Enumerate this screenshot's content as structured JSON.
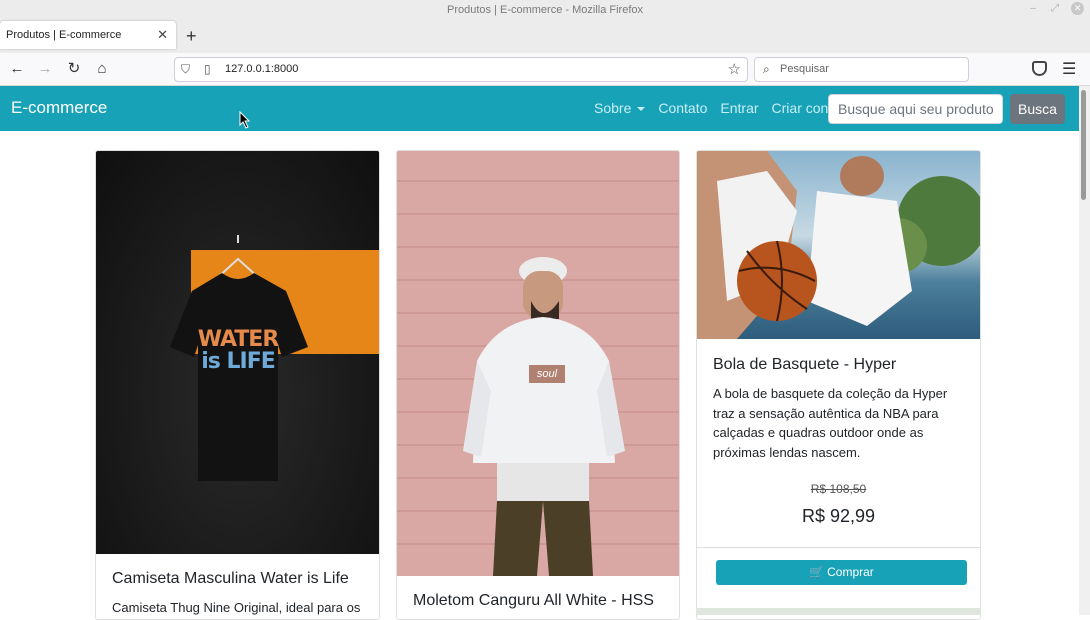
{
  "window": {
    "title": "Produtos | E-commerce - Mozilla Firefox"
  },
  "tab": {
    "label": "Produtos | E-commerce"
  },
  "browser": {
    "url": "127.0.0.1:8000",
    "search_placeholder": "Pesquisar"
  },
  "site": {
    "brand": "E-commerce",
    "nav": {
      "sobre": "Sobre",
      "contato": "Contato",
      "entrar": "Entrar",
      "criar_conta": "Criar conta"
    },
    "search_placeholder": "Busque aqui seu produto",
    "search_button": "Busca"
  },
  "products": [
    {
      "title": "Camiseta Masculina Water is Life",
      "text": "Camiseta Thug Nine Original, ideal para os",
      "shirt_text_1": "WATER",
      "shirt_text_2": "is LIFE"
    },
    {
      "title": "Moletom Canguru All White - HSS",
      "hoodie_text": "soul"
    },
    {
      "title": "Bola de Basquete - Hyper",
      "text": "A bola de basquete da coleção da Hyper traz a sensação autêntica da NBA para calçadas e quadras outdoor onde as próximas lendas nascem.",
      "old_price": "R$ 108,50",
      "price": "R$ 92,99",
      "buy_label": "Comprar"
    }
  ],
  "colors": {
    "primary": "#17a2b8",
    "secondary": "#6c757d"
  }
}
